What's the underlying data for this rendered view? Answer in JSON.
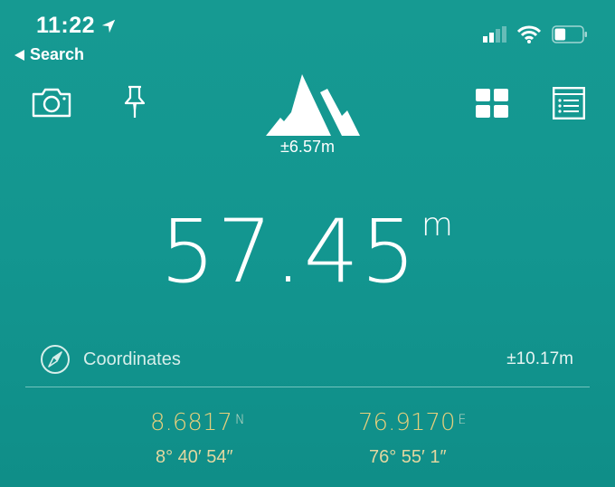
{
  "status_bar": {
    "time": "11:22",
    "location_icon": "location-arrow-icon",
    "back_label": "Search",
    "signal_icon": "cellular-signal-icon",
    "wifi_icon": "wifi-icon",
    "battery_icon": "battery-icon",
    "battery_level_percent": 40
  },
  "toolbar": {
    "camera_icon": "camera-icon",
    "pin_icon": "pushpin-icon",
    "mountain_icon": "mountain-icon",
    "grid_icon": "grid-icon",
    "list_icon": "list-icon"
  },
  "altitude": {
    "accuracy": "±6.57m",
    "value": "57.45",
    "unit": "m"
  },
  "coordinates": {
    "label": "Coordinates",
    "accuracy": "±10.17m",
    "latitude": {
      "decimal": "8.6817",
      "hemisphere": "N",
      "dms": "8° 40′ 54″"
    },
    "longitude": {
      "decimal": "76.9170",
      "hemisphere": "E",
      "dms": "76° 55′ 1″"
    }
  },
  "colors": {
    "background": "#13978f",
    "accent_gold": "#e6cf7c"
  }
}
